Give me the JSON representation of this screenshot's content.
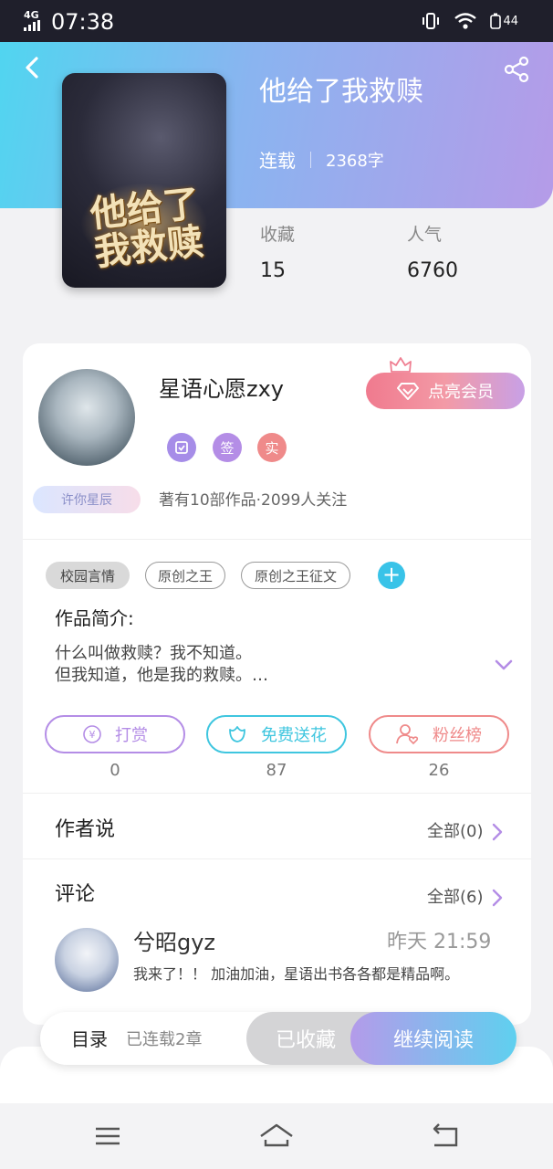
{
  "status_bar": {
    "network": "4G",
    "time": "07:38",
    "battery": "44"
  },
  "book": {
    "title": "他给了我救赎",
    "status": "连载",
    "word_count": "2368字",
    "cover_text": "他给了我救赎",
    "stats": [
      {
        "label": "收藏",
        "value": "15"
      },
      {
        "label": "人气",
        "value": "6760"
      }
    ]
  },
  "author": {
    "name": "星语心愿zxy",
    "vip_button": "点亮会员",
    "badges": [
      "签",
      "实"
    ],
    "title_tag": "许你星辰",
    "info": "著有10部作品·2099人关注"
  },
  "tags": [
    "校园言情",
    "原创之王",
    "原创之王征文"
  ],
  "intro": {
    "label": "作品简介:",
    "line1": "什么叫做救赎？我不知道。",
    "line2": "但我知道，他是我的救赎。…"
  },
  "actions": [
    {
      "label": "打赏",
      "count": "0",
      "color": "#b48de6"
    },
    {
      "label": "免费送花",
      "count": "87",
      "color": "#3fc6df"
    },
    {
      "label": "粉丝榜",
      "count": "26",
      "color": "#ef8a8a"
    }
  ],
  "author_says": {
    "title": "作者说",
    "more": "全部(0)"
  },
  "comments": {
    "title": "评论",
    "more": "全部(6)",
    "items": [
      {
        "user": "兮昭gyz",
        "time": "昨天 21:59",
        "text": "我来了！！ 加油加油，星语出书各各都是精品啊。"
      }
    ]
  },
  "bottom_bar": {
    "toc_label": "目录",
    "toc_sub": "已连载2章",
    "collected": "已收藏",
    "continue": "继续阅读"
  },
  "colors": {
    "accent_purple": "#b48de6",
    "accent_cyan": "#3fc6df",
    "accent_red": "#ef8a8a"
  }
}
